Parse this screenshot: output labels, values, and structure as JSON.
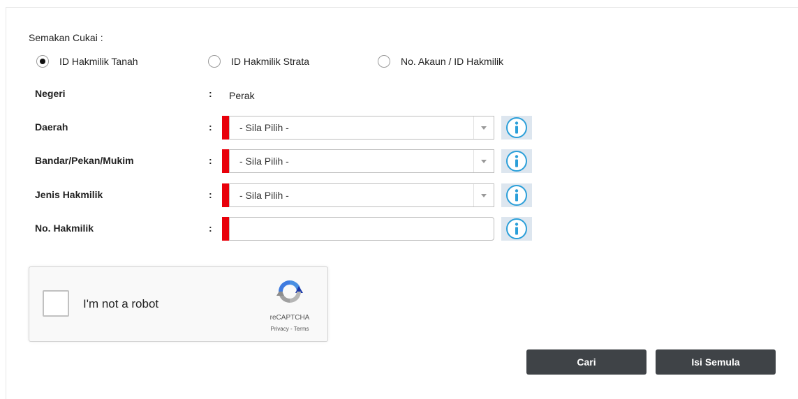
{
  "form": {
    "section_label": "Semakan Cukai :",
    "search_type": {
      "options": [
        {
          "label": "ID Hakmilik Tanah",
          "selected": true
        },
        {
          "label": "ID Hakmilik Strata",
          "selected": false
        },
        {
          "label": "No. Akaun / ID Hakmilik",
          "selected": false
        }
      ]
    },
    "fields": {
      "negeri": {
        "label": "Negeri",
        "colon": ":",
        "value": "Perak"
      },
      "daerah": {
        "label": "Daerah",
        "colon": ":",
        "selected": "- Sila Pilih -",
        "required": true
      },
      "bandar": {
        "label": "Bandar/Pekan/Mukim",
        "colon": ":",
        "selected": "- Sila Pilih -",
        "required": true
      },
      "jenis": {
        "label": "Jenis Hakmilik",
        "colon": ":",
        "selected": "- Sila Pilih -",
        "required": true
      },
      "no_hakmilik": {
        "label": "No. Hakmilik",
        "colon": ":",
        "value": "",
        "placeholder": "",
        "required": true
      }
    },
    "info_icon": "info-circle-icon"
  },
  "captcha": {
    "label": "I'm not a robot",
    "brand": "reCAPTCHA",
    "privacy": "Privacy",
    "separator": " - ",
    "terms": "Terms",
    "checked": false
  },
  "buttons": {
    "search": "Cari",
    "reset": "Isi Semula"
  },
  "colors": {
    "required_marker": "#e8000b",
    "button_bg": "#3f4347",
    "info_bg": "#dde6ef",
    "info_icon": "#2b9fd9"
  }
}
